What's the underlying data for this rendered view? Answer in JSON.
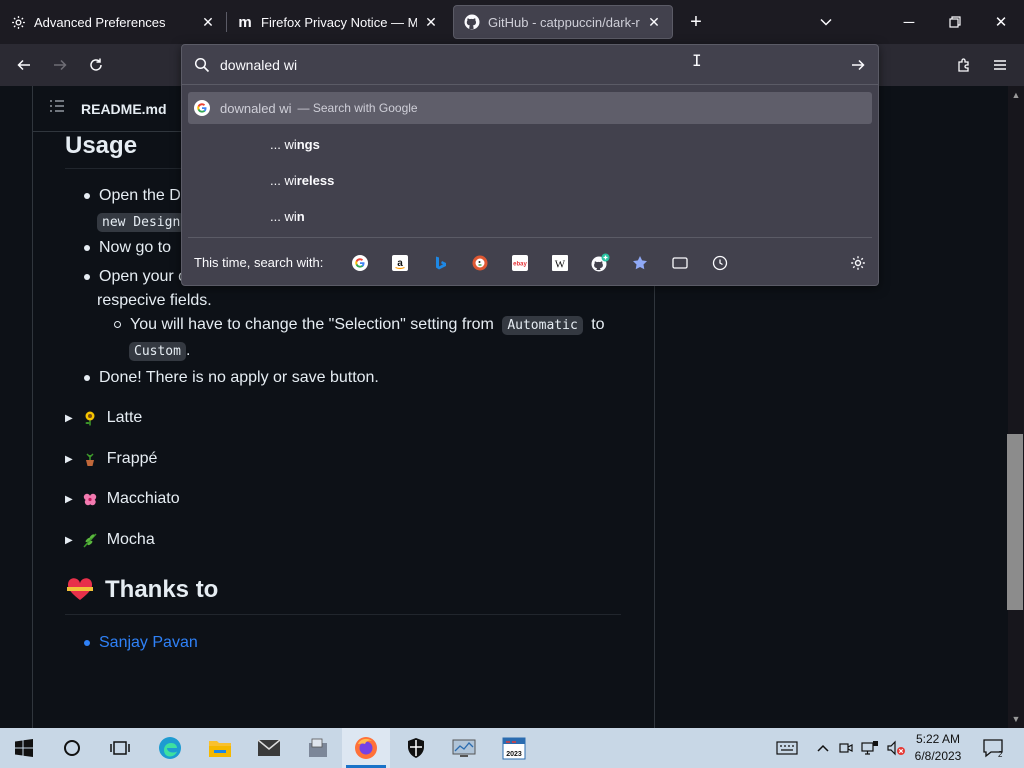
{
  "tabs": [
    {
      "title": "Advanced Preferences",
      "icon": "gear-icon"
    },
    {
      "title": "Firefox Privacy Notice — Mozill",
      "icon": "mozilla-icon"
    },
    {
      "title": "GitHub - catppuccin/dark-read",
      "icon": "github-icon",
      "active": true
    }
  ],
  "urlbar": {
    "value": "downaled wi",
    "suggestions": [
      {
        "text": "downaled wi",
        "action": "— Search with Google",
        "selected": true
      },
      {
        "prefix": "... wi",
        "bold": "ngs"
      },
      {
        "prefix": "... wi",
        "bold": "reless"
      },
      {
        "prefix": "... wi",
        "bold": "n"
      }
    ],
    "one_off_label": "This time, search with:",
    "engines": [
      "google",
      "amazon",
      "bing",
      "duckduckgo",
      "ebay",
      "wikipedia",
      "github-add",
      "bookmarks",
      "tabs",
      "history"
    ]
  },
  "page": {
    "readme_label": "README.md",
    "heading_usage": "Usage",
    "bullet1_text": "Open the Da",
    "bullet1_code": "new Design",
    "bullet2_text": "Now go to",
    "bullet3_text": "Open your c",
    "bullet3_cont": "respecive fields.",
    "sub_bullet_pre": "You will have to change the \"Selection\" setting from",
    "sub_bullet_code1": "Automatic",
    "sub_bullet_to": "to",
    "sub_bullet_code2": "Custom",
    "sub_bullet_end": ".",
    "bullet4_text": "Done! There is no apply or save button.",
    "flavors": [
      {
        "name": "Latte",
        "emoji": "sunflower"
      },
      {
        "name": "Frappé",
        "emoji": "potted-plant"
      },
      {
        "name": "Macchiato",
        "emoji": "hibiscus"
      },
      {
        "name": "Mocha",
        "emoji": "herb"
      }
    ],
    "heading_thanks": "Thanks to",
    "thanks_link": "Sanjay Pavan"
  },
  "taskbar": {
    "time": "5:22 AM",
    "date": "6/8/2023",
    "notification_count": "2"
  },
  "colors": {
    "accent": "#2f81f7",
    "chrome": "#2b2a33",
    "page_bg": "#0d1117"
  }
}
